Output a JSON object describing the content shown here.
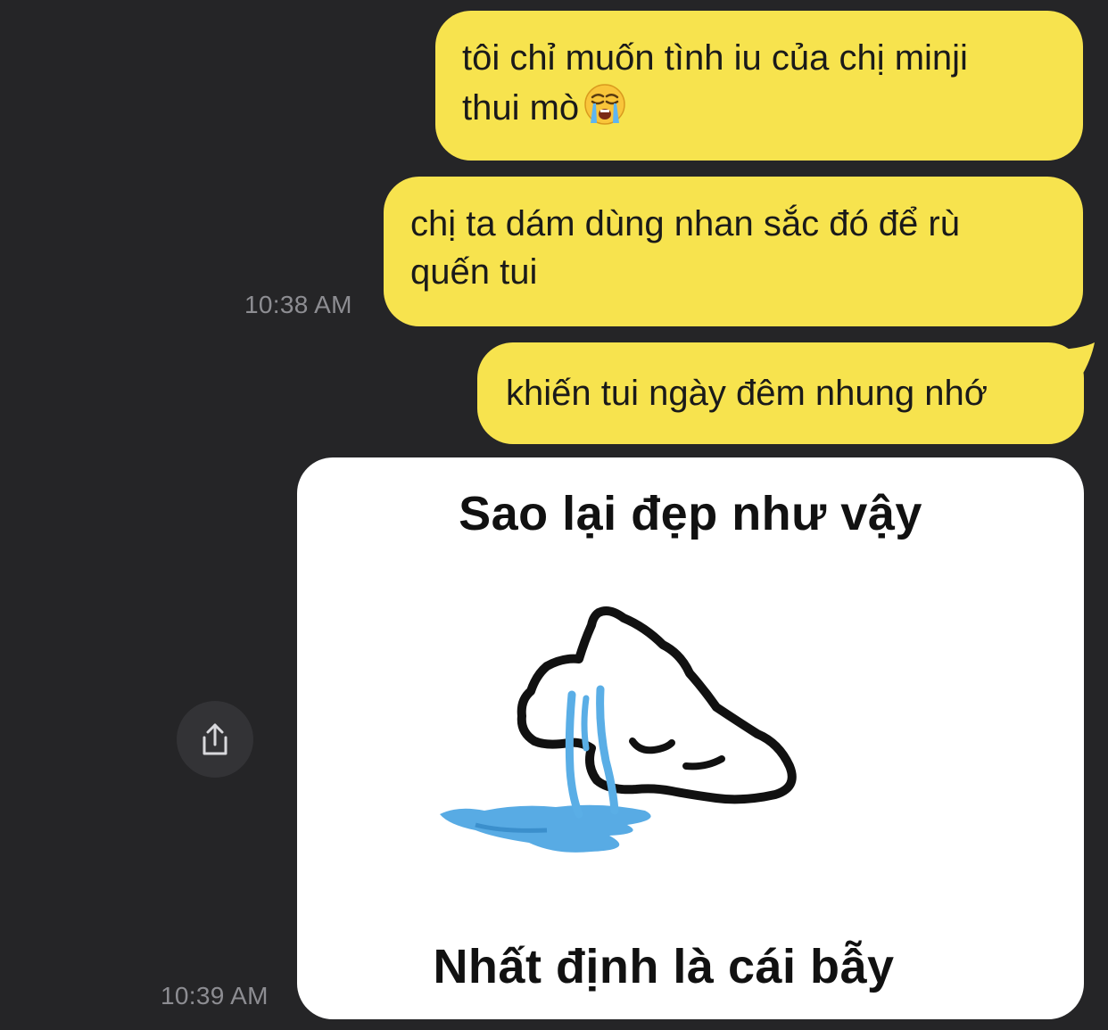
{
  "messages": [
    {
      "text": "tôi chỉ muốn tình iu của chị minji",
      "text2": "thui mò",
      "emoji": "loudly-crying-face"
    },
    {
      "text": "chị ta dám dùng nhan sắc đó để rù",
      "text2": "quến tui"
    },
    {
      "text": "khiến tui ngày đêm nhung nhớ"
    }
  ],
  "timestamps": {
    "first": "10:38 AM",
    "second": "10:39 AM"
  },
  "meme": {
    "top_text": "Sao lại đẹp như vậy",
    "bottom_text": "Nhất định là cái bẫy",
    "subject": "crying-cat-drawing"
  },
  "colors": {
    "background": "#252527",
    "bubble": "#f7e34e",
    "timestamp": "#8d8d92",
    "tears": "#4fa7e3"
  },
  "icons": {
    "share": "share-icon"
  }
}
